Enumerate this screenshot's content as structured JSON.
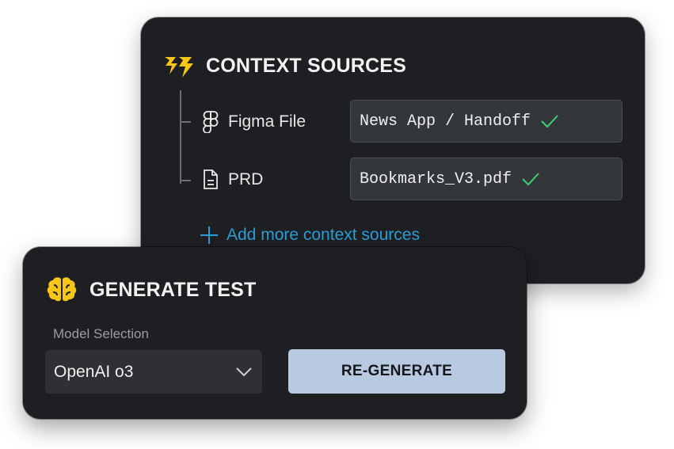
{
  "context_sources": {
    "title": "CONTEXT SOURCES",
    "icon": "bolt-icon",
    "items": [
      {
        "label": "Figma File",
        "icon": "figma-icon",
        "value": "News App / Handoff",
        "status": "verified"
      },
      {
        "label": "PRD",
        "icon": "document-icon",
        "value": "Bookmarks_V3.pdf",
        "status": "verified"
      }
    ],
    "add_more_label": "Add more context sources"
  },
  "generate_test": {
    "title": "GENERATE TEST",
    "icon": "brain-icon",
    "model_label": "Model Selection",
    "model_value": "OpenAI o3",
    "button_label": "RE-GENERATE"
  },
  "colors": {
    "card_background": "#1e1f22",
    "field_background": "#33363a",
    "accent_yellow": "#f5c518",
    "check_green": "#3ecf6e",
    "link_blue": "#2a9fd6",
    "button_background": "#b8cae1"
  }
}
